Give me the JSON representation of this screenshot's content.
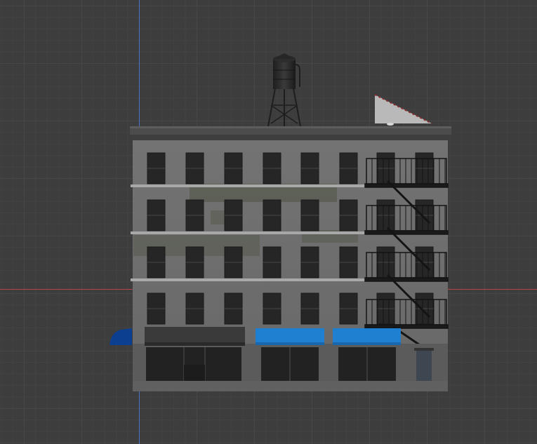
{
  "app": "3D viewport",
  "colors": {
    "background": "#3d3d3d",
    "grid_minor": "#424242",
    "grid_major": "#474747",
    "axis_x": "#b4464a",
    "axis_y": "#4a73c9",
    "facade": "#6e6e6e",
    "window": "#262626",
    "ledge": "#a8a8a8",
    "awning_blue": "#1f7fd1",
    "awning_dark": "#3a3a3a",
    "awning_navy": "#0d3f91"
  },
  "scene": {
    "object": "apartment-building-model",
    "floors": 4,
    "windows_per_floor": 8,
    "has_water_tower": true,
    "has_fire_escape": true,
    "storefront_awnings": [
      "navy",
      "dark",
      "blue",
      "blue"
    ]
  }
}
